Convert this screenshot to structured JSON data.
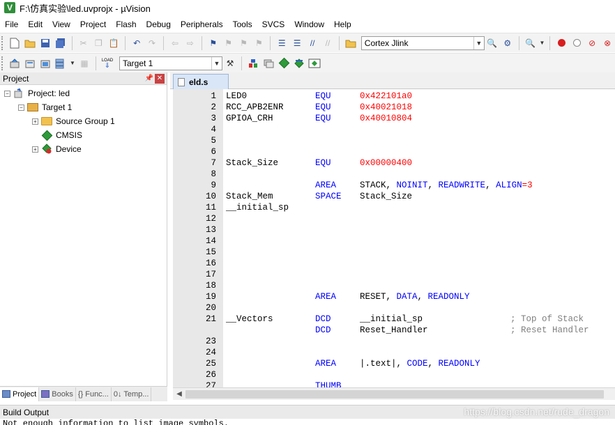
{
  "window": {
    "title": "F:\\仿真实验\\led.uvprojx - µVision",
    "logo_letter": "V"
  },
  "menu": [
    "File",
    "Edit",
    "View",
    "Project",
    "Flash",
    "Debug",
    "Peripherals",
    "Tools",
    "SVCS",
    "Window",
    "Help"
  ],
  "toolbar1": {
    "debugger_select": "Cortex Jlink"
  },
  "toolbar2": {
    "target_select": "Target 1",
    "load_label": "LOAD"
  },
  "project_pane": {
    "title": "Project",
    "pin_icon": "pin-icon",
    "tree": {
      "project": "Project: led",
      "target": "Target 1",
      "group": "Source Group 1",
      "cmsis": "CMSIS",
      "device": "Device"
    },
    "tabs": [
      "Project",
      "Books",
      "{} Func...",
      "0↓ Temp..."
    ]
  },
  "editor": {
    "tab_label": "eld.s",
    "lines": [
      {
        "n": "1",
        "c1": "LED0",
        "c2": "EQU",
        "c3": "0x422101a0"
      },
      {
        "n": "2",
        "c1": "RCC_APB2ENR",
        "c2": "EQU",
        "c3": "0x40021018"
      },
      {
        "n": "3",
        "c1": "GPIOA_CRH",
        "c2": "EQU",
        "c3": "0x40010804"
      },
      {
        "n": "4"
      },
      {
        "n": "5"
      },
      {
        "n": "6"
      },
      {
        "n": "7",
        "c1": "Stack_Size",
        "c2": "EQU",
        "c3": "0x00000400"
      },
      {
        "n": "8"
      },
      {
        "n": "9",
        "c2": "AREA",
        "c3": "STACK, NOINIT, READWRITE, ALIGN=3"
      },
      {
        "n": "10",
        "c1": "Stack_Mem",
        "c2": "SPACE",
        "c3": "Stack_Size"
      },
      {
        "n": "11",
        "c1": "__initial_sp"
      },
      {
        "n": "12"
      },
      {
        "n": "13"
      },
      {
        "n": "14"
      },
      {
        "n": "15"
      },
      {
        "n": "16"
      },
      {
        "n": "17"
      },
      {
        "n": "18"
      },
      {
        "n": "19",
        "c2": "AREA",
        "c3": "RESET, DATA, READONLY"
      },
      {
        "n": "20"
      },
      {
        "n": "21",
        "c1": "__Vectors",
        "c2": "DCD",
        "c3": "__initial_sp",
        "c4": "; Top of Stack"
      },
      {
        "n": "",
        "c2": "DCD",
        "c3": "Reset_Handler",
        "c4": "; Reset Handler"
      },
      {
        "n": "23"
      },
      {
        "n": "24"
      },
      {
        "n": "25",
        "c2": "AREA",
        "c3": "|.text|, CODE, READONLY"
      },
      {
        "n": "26"
      },
      {
        "n": "27",
        "c2": "THUMB"
      }
    ]
  },
  "build_output": {
    "title": "Build Output",
    "text": "Not enough information to list image symbols."
  },
  "watermark": "https://blog.csdn.net/rude_dragon",
  "colors": {
    "keyword": "#0000ff",
    "number": "#ff0000",
    "comment": "#7f7f7f"
  }
}
